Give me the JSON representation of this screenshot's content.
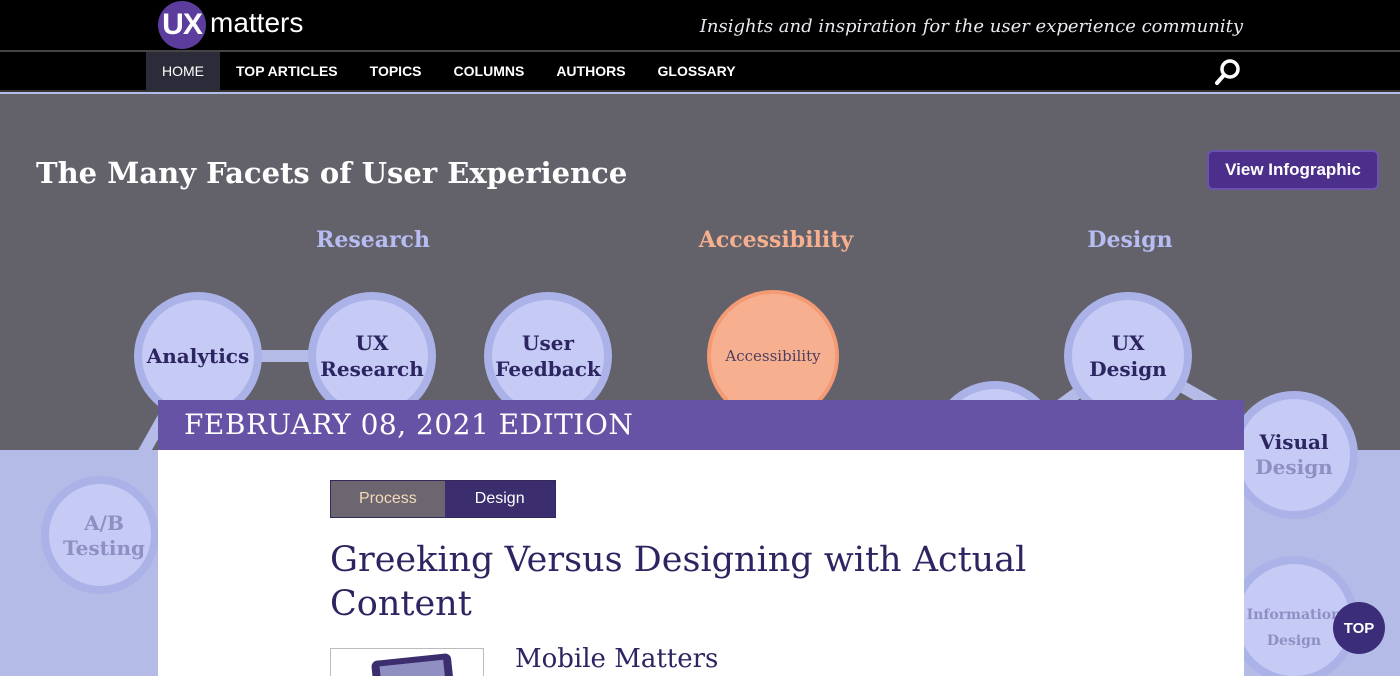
{
  "header": {
    "logo_badge": "UX",
    "logo_word": "matters",
    "tagline": "Insights and inspiration for the user experience community"
  },
  "nav": {
    "items": [
      "HOME",
      "TOP ARTICLES",
      "TOPICS",
      "COLUMNS",
      "AUTHORS",
      "GLOSSARY"
    ],
    "active": "HOME",
    "search_icon": "search-icon"
  },
  "hero": {
    "title": "The Many Facets of User Experience",
    "view_button": "View Infographic",
    "categories": {
      "research": "Research",
      "accessibility": "Accessibility",
      "design": "Design"
    },
    "nodes": {
      "analytics": "Analytics",
      "ux_research_1": "UX",
      "ux_research_2": "Research",
      "user_feedback_1": "User",
      "user_feedback_2": "Feedback",
      "accessibility": "Accessibility",
      "ux_design_1": "UX",
      "ux_design_2": "Design",
      "visual_design_1": "Visual",
      "visual_design_2": "Design",
      "ab_testing_1": "A/B",
      "ab_testing_2": "Testing",
      "info_design_1": "Information",
      "info_design_2": "Design"
    }
  },
  "edition": {
    "title": "FEBRUARY 08, 2021 EDITION",
    "tags": [
      "Process",
      "Design"
    ],
    "article_title": "Greeking Versus Designing with Actual Content",
    "column_name": "Mobile Matters"
  },
  "top_button": "TOP",
  "colors": {
    "brand_purple": "#6753a6",
    "hero_gray": "#636169",
    "node_fill": "#c5cbf5",
    "accessibility_orange": "#f7b08f"
  }
}
